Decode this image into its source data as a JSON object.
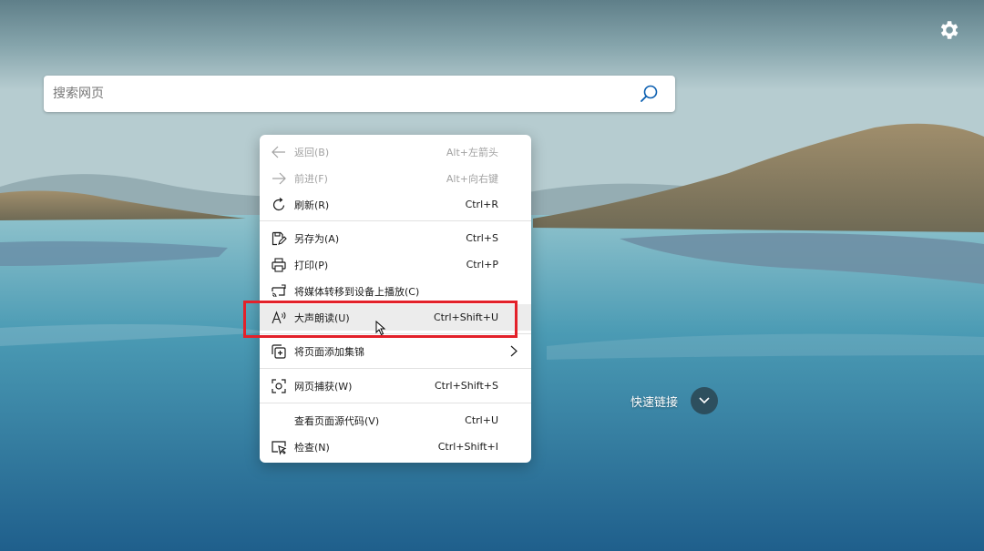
{
  "search": {
    "placeholder": "搜索网页"
  },
  "settings": {
    "icon": "gear-icon"
  },
  "quick_links": {
    "label": "快速链接",
    "icon": "chevron-down-icon"
  },
  "context_menu": {
    "items": [
      {
        "label": "返回(B)",
        "shortcut": "Alt+左箭头",
        "icon": "arrow-left-icon",
        "enabled": false
      },
      {
        "label": "前进(F)",
        "shortcut": "Alt+向右键",
        "icon": "arrow-right-icon",
        "enabled": false
      },
      {
        "label": "刷新(R)",
        "shortcut": "Ctrl+R",
        "icon": "refresh-icon",
        "enabled": true
      },
      {
        "label": "另存为(A)",
        "shortcut": "Ctrl+S",
        "icon": "save-as-icon",
        "enabled": true
      },
      {
        "label": "打印(P)",
        "shortcut": "Ctrl+P",
        "icon": "print-icon",
        "enabled": true
      },
      {
        "label": "将媒体转移到设备上播放(C)",
        "shortcut": "",
        "icon": "cast-media-icon",
        "enabled": true
      },
      {
        "label": "大声朗读(U)",
        "shortcut": "Ctrl+Shift+U",
        "icon": "read-aloud-icon",
        "enabled": true,
        "highlighted": true
      },
      {
        "label": "将页面添加集锦",
        "shortcut": "",
        "icon": "collections-icon",
        "enabled": true,
        "submenu": true
      },
      {
        "label": "网页捕获(W)",
        "shortcut": "Ctrl+Shift+S",
        "icon": "web-capture-icon",
        "enabled": true
      },
      {
        "label": "查看页面源代码(V)",
        "shortcut": "Ctrl+U",
        "icon": "",
        "enabled": true
      },
      {
        "label": "检查(N)",
        "shortcut": "Ctrl+Shift+I",
        "icon": "inspect-icon",
        "enabled": true
      }
    ]
  },
  "colors": {
    "annotation_red": "#e3212a",
    "disabled_text": "#a2a2a2",
    "highlight_bg": "#ececec"
  }
}
